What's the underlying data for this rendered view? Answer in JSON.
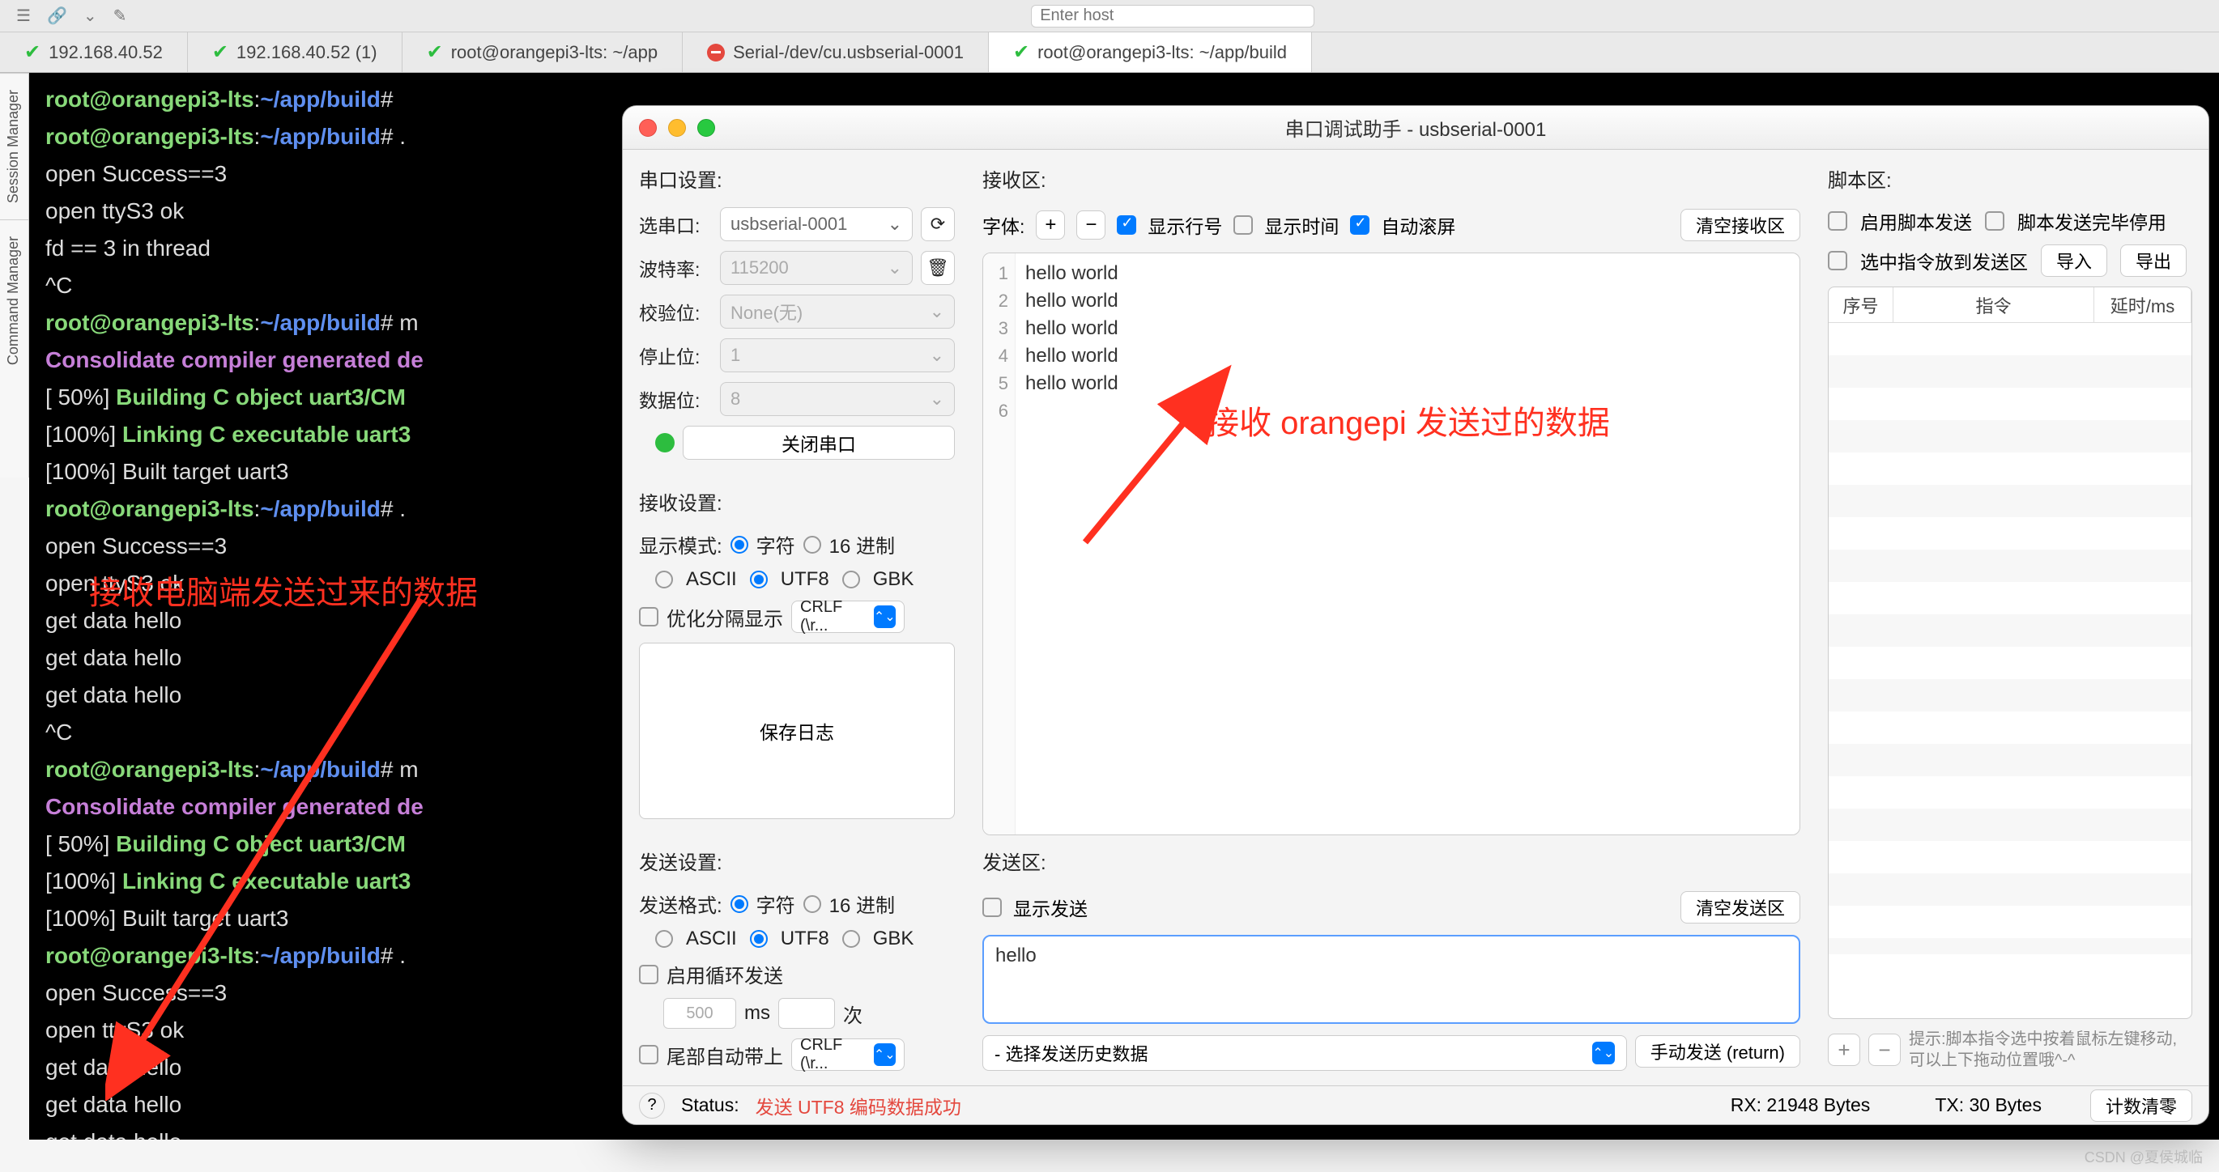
{
  "toolbar": {
    "host_placeholder": "Enter host"
  },
  "tabs": [
    {
      "label": "192.168.40.52",
      "status": "green"
    },
    {
      "label": "192.168.40.52 (1)",
      "status": "green"
    },
    {
      "label": "root@orangepi3-lts: ~/app",
      "status": "green"
    },
    {
      "label": "Serial-/dev/cu.usbserial-0001",
      "status": "red"
    },
    {
      "label": "root@orangepi3-lts: ~/app/build",
      "status": "green"
    }
  ],
  "left_tabs": {
    "session": "Session Manager",
    "command": "Command Manager"
  },
  "terminal": {
    "prompt_user": "root@orangepi3-lts",
    "prompt_path": "~/app/build",
    "lines": [
      {
        "type": "prompt",
        "cmd": ""
      },
      {
        "type": "prompt",
        "cmd": "."
      },
      {
        "type": "out",
        "text": "open Success==3"
      },
      {
        "type": "out",
        "text": "open ttyS3 ok"
      },
      {
        "type": "out",
        "text": "fd == 3 in thread"
      },
      {
        "type": "out",
        "text": "^C"
      },
      {
        "type": "prompt",
        "cmd": "m"
      },
      {
        "type": "purple",
        "text": "Consolidate compiler generated de"
      },
      {
        "type": "build50",
        "text": "Building C object uart3/CM"
      },
      {
        "type": "build100g",
        "text": "Linking C executable uart3"
      },
      {
        "type": "build100",
        "text": "Built target uart3"
      },
      {
        "type": "prompt",
        "cmd": "."
      },
      {
        "type": "out",
        "text": "open Success==3"
      },
      {
        "type": "out",
        "text": "open ttyS3 ok"
      },
      {
        "type": "out",
        "text": "get data hello"
      },
      {
        "type": "out",
        "text": "get data hello"
      },
      {
        "type": "out",
        "text": "get data hello"
      },
      {
        "type": "out",
        "text": "^C"
      },
      {
        "type": "prompt",
        "cmd": "m"
      },
      {
        "type": "purple",
        "text": "Consolidate compiler generated de"
      },
      {
        "type": "build50",
        "text": "Building C object uart3/CM"
      },
      {
        "type": "build100g",
        "text": "Linking C executable uart3"
      },
      {
        "type": "build100",
        "text": "Built target uart3"
      },
      {
        "type": "prompt",
        "cmd": "."
      },
      {
        "type": "out",
        "text": "open Success==3"
      },
      {
        "type": "out",
        "text": "open ttyS3 ok"
      },
      {
        "type": "out",
        "text": "get data hello"
      },
      {
        "type": "out",
        "text": "get data hello"
      },
      {
        "type": "out",
        "text": "get data hello"
      }
    ]
  },
  "serial": {
    "title": "串口调试助手 - usbserial-0001",
    "port_settings": {
      "header": "串口设置:",
      "port_label": "选串口:",
      "port_value": "usbserial-0001",
      "baud_label": "波特率:",
      "baud_value": "115200",
      "parity_label": "校验位:",
      "parity_value": "None(无)",
      "stop_label": "停止位:",
      "stop_value": "1",
      "data_label": "数据位:",
      "data_value": "8",
      "close_btn": "关闭串口"
    },
    "recv_settings": {
      "header": "接收设置:",
      "mode_label": "显示模式:",
      "mode_char": "字符",
      "mode_hex": "16 进制",
      "enc_ascii": "ASCII",
      "enc_utf8": "UTF8",
      "enc_gbk": "GBK",
      "sep_label": "优化分隔显示",
      "sep_value": "CRLF (\\r...",
      "save_btn": "保存日志"
    },
    "send_settings": {
      "header": "发送设置:",
      "fmt_label": "发送格式:",
      "fmt_char": "字符",
      "fmt_hex": "16 进制",
      "enc_ascii": "ASCII",
      "enc_utf8": "UTF8",
      "enc_gbk": "GBK",
      "loop_label": "启用循环发送",
      "loop_value": "500",
      "loop_ms": "ms",
      "loop_times": "次",
      "tail_label": "尾部自动带上",
      "tail_value": "CRLF (\\r..."
    },
    "recv_area": {
      "header": "接收区:",
      "font_label": "字体:",
      "show_lineno": "显示行号",
      "show_time": "显示时间",
      "auto_scroll": "自动滚屏",
      "clear_btn": "清空接收区",
      "lines": [
        "hello world",
        "hello world",
        "hello world",
        "hello world",
        "hello world"
      ]
    },
    "send_area": {
      "header": "发送区:",
      "show_send": "显示发送",
      "clear_btn": "清空发送区",
      "content": "hello",
      "history_placeholder": "- 选择发送历史数据",
      "send_btn": "手动发送 (return)"
    },
    "script": {
      "header": "脚本区:",
      "enable_send": "启用脚本发送",
      "half_pause": "脚本发送完毕停用",
      "put_selected": "选中指令放到发送区",
      "import_btn": "导入",
      "export_btn": "导出",
      "col_seq": "序号",
      "col_cmd": "指令",
      "col_delay": "延时/ms",
      "hint": "提示:脚本指令选中按着鼠标左键移动,可以上下拖动位置哦^-^"
    },
    "status": {
      "label": "Status:",
      "msg": "发送 UTF8 编码数据成功",
      "rx": "RX:  21948 Bytes",
      "tx": "TX: 30 Bytes",
      "reset": "计数清零"
    }
  },
  "annotations": {
    "left": "接收电脑端发送过来的数据",
    "right": "接收 orangepi 发送过的数据"
  },
  "watermark": "CSDN @夏侯城临"
}
